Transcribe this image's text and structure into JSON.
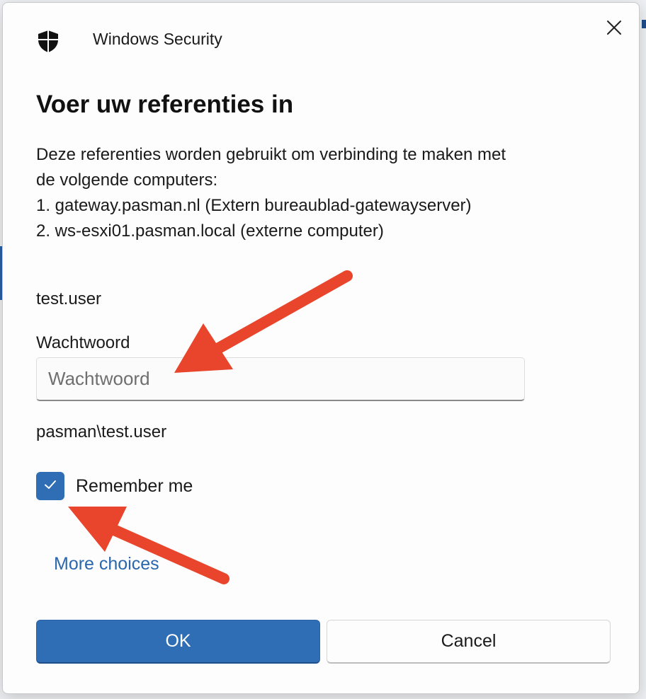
{
  "window": {
    "app_title": "Windows Security",
    "close_icon": "close-icon"
  },
  "dialog": {
    "heading": "Voer uw referenties in",
    "description_lines": [
      "Deze referenties worden gebruikt om verbinding te maken met",
      "de volgende computers:",
      "1. gateway.pasman.nl (Extern bureaublad-gatewayserver)",
      "2. ws-esxi01.pasman.local (externe computer)"
    ],
    "username": "test.user",
    "password_label": "Wachtwoord",
    "password_placeholder": "Wachtwoord",
    "password_value": "",
    "domain_user": "pasman\\test.user",
    "remember_me_label": "Remember me",
    "remember_me_checked": true,
    "more_choices": "More choices",
    "ok_label": "OK",
    "cancel_label": "Cancel"
  },
  "colors": {
    "accent": "#2f6db5",
    "link": "#2a67ad",
    "annotation_arrow": "#e8452c"
  },
  "annotations": [
    {
      "type": "arrow",
      "target": "password-input",
      "icon": "arrow-annotation"
    },
    {
      "type": "arrow",
      "target": "remember-me-checkbox",
      "icon": "arrow-annotation"
    }
  ]
}
